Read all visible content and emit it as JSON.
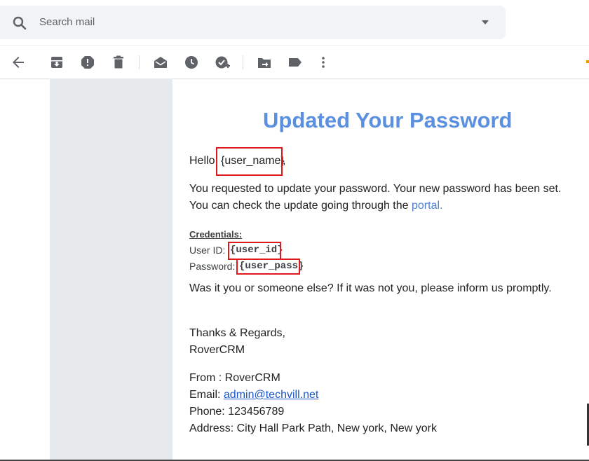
{
  "search": {
    "placeholder": "Search mail"
  },
  "toolbar": {
    "buttons": [
      "back",
      "archive",
      "report-spam",
      "delete",
      "mark-unread",
      "snooze",
      "add-to-tasks",
      "move-to",
      "labels",
      "more"
    ]
  },
  "email": {
    "title": "Updated Your Password",
    "greeting_prefix": "Hello",
    "greeting_var": "{user_name}",
    "greeting_suffix": ",",
    "body_line1": "You requested to update your password. Your new password has been set.",
    "body_line2_prefix": "You can check the update going through the",
    "body_line2_link": "portal.",
    "credentials_label": "Credentials:",
    "user_id_label": "User ID:",
    "user_id_var": "{user_id}",
    "password_label": "Password:",
    "password_var": "{user_pass}",
    "warning": "Was it you or someone else? If it was not you, please inform us promptly.",
    "regards": "Thanks & Regards,",
    "signature": "RoverCRM",
    "from_line": "From : RoverCRM",
    "email_label": "Email:",
    "email_value": "admin@techvill.net",
    "phone_line": "Phone: 123456789",
    "address_line": "Address: City Hall Park Path, New york, New york"
  },
  "colors": {
    "title": "#5b8fdf",
    "highlight_box": "#e0191c",
    "link": "#1a56c8"
  }
}
